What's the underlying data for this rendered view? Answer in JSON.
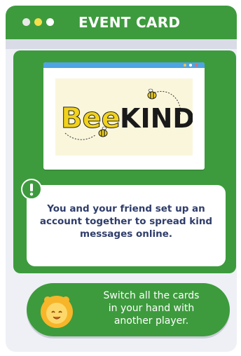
{
  "header": {
    "title": "EVENT CARD",
    "dots": [
      "#e8e8e8",
      "#f5e04a",
      "#ffffff"
    ],
    "color": "#3d9b3d"
  },
  "illustration": {
    "logo_text_part1": "Bee",
    "logo_text_part2": "KIND",
    "browser_dots": [
      "#f6c343",
      "#ffffff",
      "#e86a6a"
    ]
  },
  "event": {
    "icon": "exclamation-icon",
    "message": "You and your friend set up an account together to spread kind messages online."
  },
  "action": {
    "icon": "lion-icon",
    "line1": "Switch all the cards",
    "line2": "in your hand with",
    "line3": "another player."
  }
}
